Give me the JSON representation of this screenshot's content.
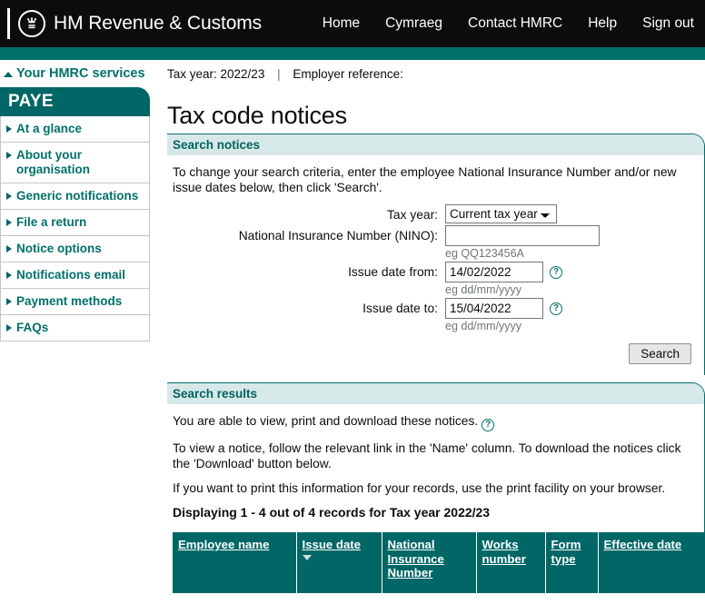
{
  "header": {
    "brand": "HM Revenue & Customs",
    "logo_icon": "hmrc-crown-icon",
    "nav": [
      {
        "label": "Home"
      },
      {
        "label": "Cymraeg"
      },
      {
        "label": "Contact HMRC"
      },
      {
        "label": "Help"
      },
      {
        "label": "Sign out"
      }
    ]
  },
  "services_link": {
    "label": "Your HMRC services",
    "icon": "caret-up-icon"
  },
  "context_bar": {
    "tax_year": "Tax year: 2022/23",
    "separator": "|",
    "employer_reference": "Employer reference:"
  },
  "sidebar": {
    "title": "PAYE",
    "items": [
      {
        "label": "At a glance"
      },
      {
        "label": "About your organisation"
      },
      {
        "label": "Generic notifications"
      },
      {
        "label": "File a return"
      },
      {
        "label": "Notice options"
      },
      {
        "label": "Notifications email"
      },
      {
        "label": "Payment methods"
      },
      {
        "label": "FAQs"
      }
    ]
  },
  "page_title": "Tax code notices",
  "search_panel": {
    "heading": "Search notices",
    "intro": "To change your search criteria, enter the employee National Insurance Number and/or new issue dates below, then click 'Search'.",
    "fields": {
      "tax_year": {
        "label": "Tax year:",
        "value": "Current tax year",
        "options": [
          "Current tax year"
        ]
      },
      "nino": {
        "label": "National Insurance Number (NINO):",
        "value": "",
        "placeholder": "",
        "hint": "eg QQ123456A"
      },
      "issue_date_from": {
        "label": "Issue date from:",
        "value": "14/02/2022",
        "hint": "eg dd/mm/yyyy",
        "help_icon": "help-circle-icon"
      },
      "issue_date_to": {
        "label": "Issue date to:",
        "value": "15/04/2022",
        "hint": "eg dd/mm/yyyy",
        "help_icon": "help-circle-icon"
      }
    },
    "search_button": "Search"
  },
  "results_panel": {
    "heading": "Search results",
    "line1": "You are able to view, print and download these notices.",
    "line1_help_icon": "help-circle-icon",
    "line2": "To view a notice, follow the relevant link in the 'Name' column. To download the notices click the 'Download' button below.",
    "line3": "If you want to print this information for your records, use the print facility on your browser.",
    "displaying": "Displaying 1 - 4 out of 4 records for Tax year 2022/23",
    "table": {
      "columns": [
        {
          "label": "Employee name",
          "sorted": false
        },
        {
          "label": "Issue date",
          "sorted": true,
          "sort_direction": "descending"
        },
        {
          "label": "National Insurance Number",
          "sorted": false
        },
        {
          "label": "Works number",
          "sorted": false
        },
        {
          "label": "Form type",
          "sorted": false
        },
        {
          "label": "Effective date",
          "sorted": false
        }
      ],
      "rows": []
    }
  },
  "colors": {
    "black_bar": "#0b0c0c",
    "teal": "#006666",
    "teal_band": "#00706b",
    "panel_head_bg": "#d7e8e8",
    "panel_head_text": "#00635e",
    "link_white": "#ffffff",
    "hint_grey": "#6f7777"
  }
}
